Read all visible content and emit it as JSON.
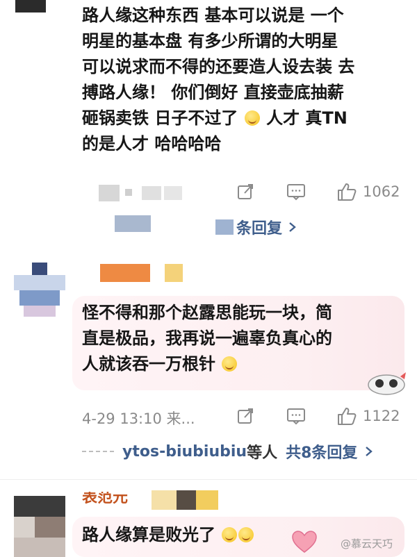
{
  "comment1": {
    "lines": [
      "路人缘这种东西 基本可以说是 一个",
      "明星的基本盘 有多少所谓的大明星",
      "可以说求而不得的还要造人设去装 去",
      "搏路人缘！ 你们倒好 直接壶底抽薪",
      "砸锅卖铁 日子不过了",
      "的是人才 哈哈哈哈"
    ],
    "line5_tail": "人才 真TN",
    "likes": "1062",
    "reply_link": "条回复"
  },
  "comment2": {
    "lines": [
      "怪不得和那个赵露思能玩一块，简",
      "直是极品，我再说一遍辜负真心的",
      "人就该吞一万根针"
    ],
    "timestamp": "4-29 13:10 来...",
    "likes": "1122",
    "reply_users": "ytos-biubiubiu",
    "reply_users_suffix": "等人",
    "reply_count": "共8条回复"
  },
  "comment3": {
    "username_partial": "表范元",
    "text": "路人缘算是败光了"
  },
  "watermark": "@慕云天巧",
  "icons": {
    "share": "share-icon",
    "comment": "comment-icon",
    "like": "thumbs-up-icon",
    "chevron": "chevron-right-icon"
  }
}
